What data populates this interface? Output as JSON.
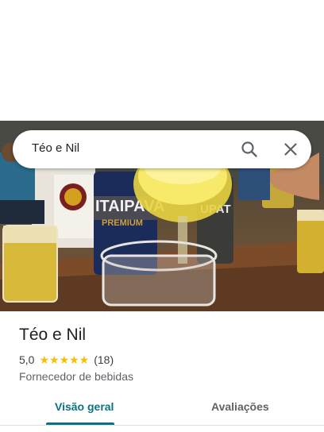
{
  "search": {
    "query": "Téo e Nil"
  },
  "icons": {
    "search": "search-icon",
    "close": "close-icon",
    "star": "star-icon"
  },
  "place": {
    "name": "Téo e Nil",
    "rating": "5,0",
    "stars": "★★★★★",
    "review_count": "(18)",
    "category": "Fornecedor de bebidas"
  },
  "photo": {
    "can_label": "ITAIPAVA",
    "can_sublabel": "PREMIUM",
    "can2_label": "UPAT"
  },
  "tabs": [
    {
      "label": "Visão geral",
      "selected": true
    },
    {
      "label": "Avaliações",
      "selected": false
    }
  ],
  "colors": {
    "accent": "#0b7285",
    "star": "#fbbc04",
    "text": "#202124",
    "secondary": "#5f6368"
  }
}
